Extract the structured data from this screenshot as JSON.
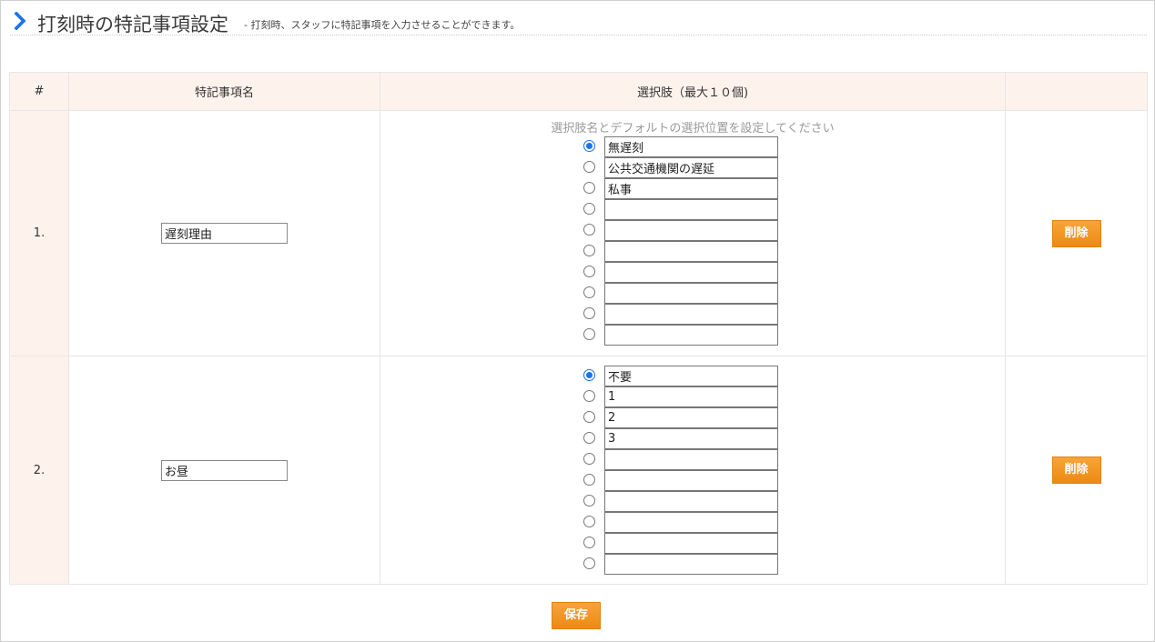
{
  "header": {
    "title": "打刻時の特記事項設定",
    "subtitle": "- 打刻時、スタッフに特記事項を入力させることができます。"
  },
  "table": {
    "columns": {
      "index": "#",
      "name": "特記事項名",
      "choices": "選択肢（最大１０個)",
      "action": ""
    },
    "hint": "選択肢名とデフォルトの選択位置を設定してください",
    "rows": [
      {
        "index": "1.",
        "name": "遅刻理由",
        "delete_label": "削除",
        "options": [
          {
            "text": "無遅刻",
            "selected": true
          },
          {
            "text": "公共交通機関の遅延",
            "selected": false
          },
          {
            "text": "私事",
            "selected": false
          },
          {
            "text": "",
            "selected": false
          },
          {
            "text": "",
            "selected": false
          },
          {
            "text": "",
            "selected": false
          },
          {
            "text": "",
            "selected": false
          },
          {
            "text": "",
            "selected": false
          },
          {
            "text": "",
            "selected": false
          },
          {
            "text": "",
            "selected": false
          }
        ]
      },
      {
        "index": "2.",
        "name": "お昼",
        "delete_label": "削除",
        "options": [
          {
            "text": "不要",
            "selected": true
          },
          {
            "text": "1",
            "selected": false
          },
          {
            "text": "2",
            "selected": false
          },
          {
            "text": "3",
            "selected": false
          },
          {
            "text": "",
            "selected": false
          },
          {
            "text": "",
            "selected": false
          },
          {
            "text": "",
            "selected": false
          },
          {
            "text": "",
            "selected": false
          },
          {
            "text": "",
            "selected": false
          },
          {
            "text": "",
            "selected": false
          }
        ]
      }
    ]
  },
  "save_label": "保存",
  "colors": {
    "accent": "#1a73e8",
    "button": "#f29a24",
    "header_bg": "#fdf3ec"
  }
}
